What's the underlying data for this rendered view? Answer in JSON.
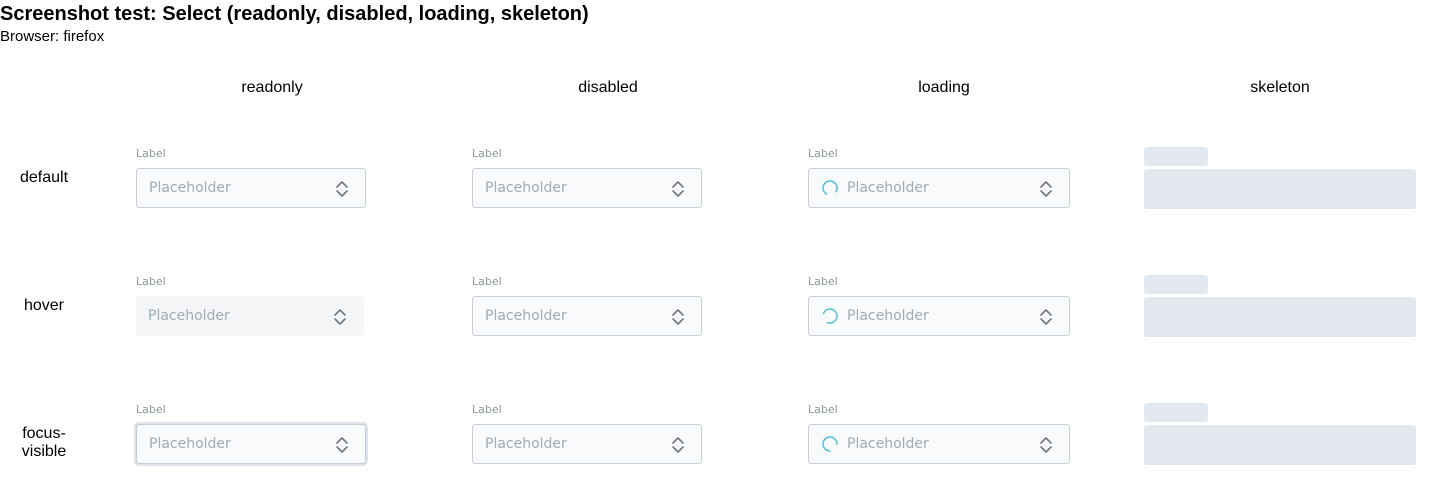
{
  "page": {
    "title": "Screenshot test: Select (readonly, disabled, loading, skeleton)",
    "browser": "Browser: firefox"
  },
  "columns": [
    "readonly",
    "disabled",
    "loading",
    "skeleton"
  ],
  "rows": [
    "default",
    "hover",
    "focus-visible"
  ],
  "select": {
    "label": "Label",
    "placeholder": "Placeholder"
  },
  "icons": {
    "chevron": "chevron-up-down-icon",
    "spinner": "loading-spinner-icon"
  },
  "colors": {
    "border": "#c9cfd6",
    "field_bg": "#f8fafb",
    "placeholder": "#a2aab4",
    "label": "#8b939e",
    "skeleton": "#e3e8ee",
    "spinner": "#4fc3d9",
    "chevron": "#6f7781"
  }
}
